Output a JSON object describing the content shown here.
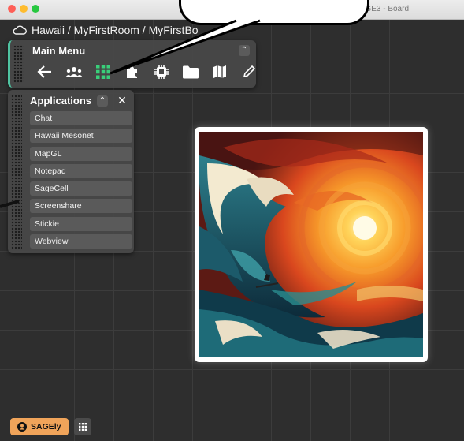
{
  "window": {
    "title": "SAGE3 - Board"
  },
  "breadcrumb": {
    "text": "Hawaii / MyFirstRoom / MyFirstBo"
  },
  "main_menu": {
    "title": "Main Menu",
    "collapse_symbol": "⌃",
    "tools": [
      "back-arrow-icon",
      "users-icon",
      "apps-grid-icon",
      "puzzle-icon",
      "chip-icon",
      "folder-icon",
      "map-icon",
      "pencil-icon"
    ]
  },
  "applications": {
    "title": "Applications",
    "collapse_symbol": "⌃",
    "close_symbol": "✕",
    "items": [
      "Chat",
      "Hawaii Mesonet",
      "MapGL",
      "Notepad",
      "SageCell",
      "Screenshare",
      "Stickie",
      "Webview"
    ]
  },
  "footer": {
    "user_label": "SAGEly"
  },
  "colors": {
    "accent": "#4fc3a1",
    "user_button": "#f0a45a",
    "apps_icon": "#39d07a"
  }
}
